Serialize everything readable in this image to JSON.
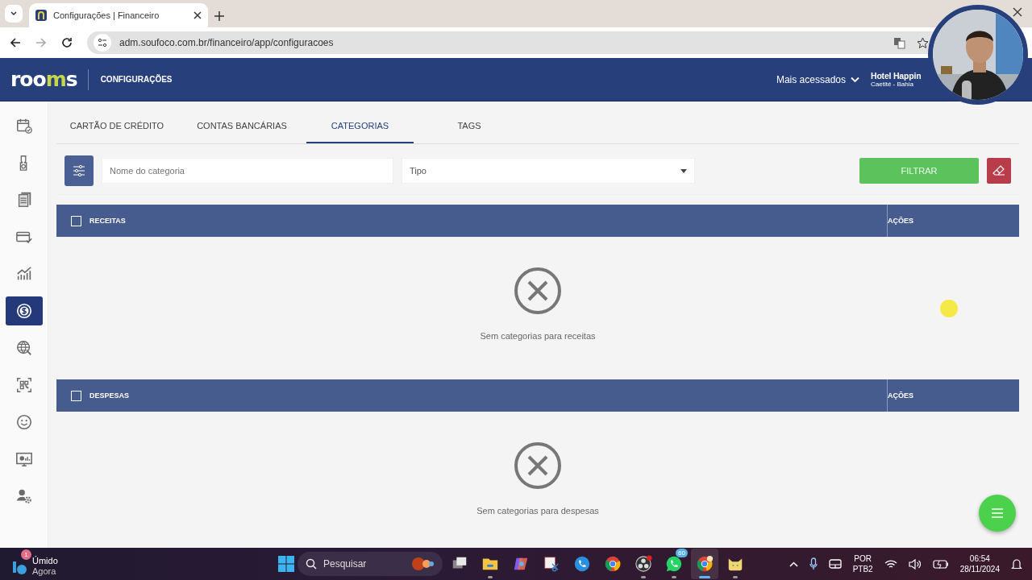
{
  "browser": {
    "tab_title": "Configurações | Financeiro",
    "url": "adm.soufoco.com.br/financeiro/app/configuracoes"
  },
  "header": {
    "logo": [
      {
        "text": "roo",
        "accent": false
      },
      {
        "text": "m",
        "accent": true
      },
      {
        "text": "s",
        "accent": false
      }
    ],
    "section": "CONFIGURAÇÕES",
    "menu": "Mais acessados",
    "hotel_name": "Hotel Happin",
    "hotel_location": "Caetité - Bahia"
  },
  "sidebar": {
    "items": [
      {
        "selected": false
      },
      {
        "selected": false
      },
      {
        "selected": false
      },
      {
        "selected": false
      },
      {
        "selected": false
      },
      {
        "selected": true
      },
      {
        "selected": false
      },
      {
        "selected": false
      },
      {
        "selected": false
      },
      {
        "selected": false
      },
      {
        "selected": false
      }
    ]
  },
  "tabs": [
    {
      "label": "CARTÃO DE CRÉDITO",
      "selected": false
    },
    {
      "label": "CONTAS BANCÁRIAS",
      "selected": false
    },
    {
      "label": "CATEGORIAS",
      "selected": true
    },
    {
      "label": "TAGS",
      "selected": false
    }
  ],
  "filters": {
    "name_placeholder": "Nome do categoria",
    "type_placeholder": "Tipo",
    "button": "FILTRAR"
  },
  "sections": [
    {
      "title": "RECEITAS",
      "actions": "AÇÕES",
      "checked": false,
      "empty_message": "Sem categorias para receitas"
    },
    {
      "title": "DESPESAS",
      "actions": "AÇÕES",
      "checked": false,
      "empty_message": "Sem categorias para despesas"
    }
  ],
  "taskbar": {
    "weather": {
      "badge": "1",
      "condition": "Úmido",
      "time": "Agora"
    },
    "search": "Pesquisar",
    "apps": [
      {
        "running": false,
        "active": false
      },
      {
        "running": true,
        "active": false
      },
      {
        "running": false,
        "active": false
      },
      {
        "running": false,
        "active": false
      },
      {
        "running": false,
        "active": false
      },
      {
        "running": false,
        "active": false
      },
      {
        "running": true,
        "active": false
      },
      {
        "running": true,
        "active": false,
        "badge": "60"
      },
      {
        "running": true,
        "active": true
      },
      {
        "running": true,
        "active": false
      }
    ],
    "language": "POR",
    "layout": "PTB2",
    "time": "06:54",
    "date": "28/11/2024"
  }
}
